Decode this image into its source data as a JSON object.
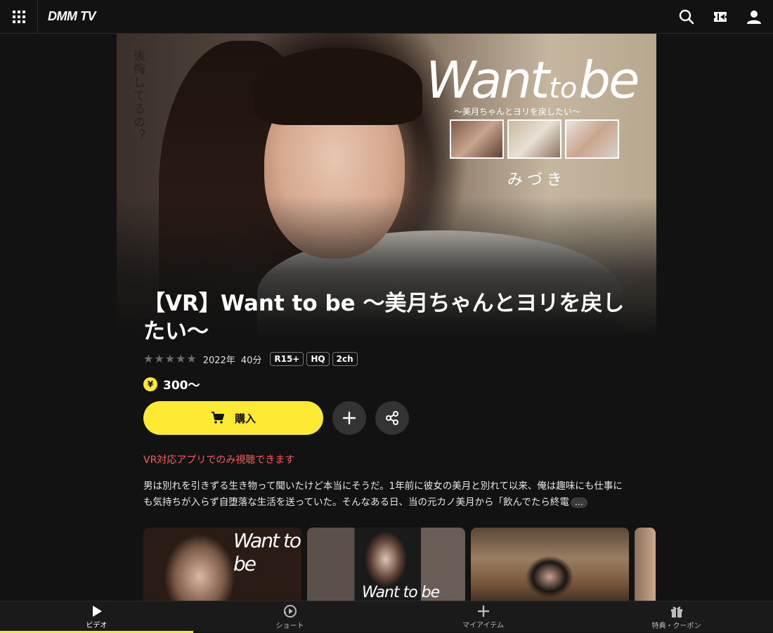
{
  "header": {
    "logo": "DMM TV",
    "icons": [
      "grid-menu-icon",
      "search-icon",
      "ticket-icon",
      "user-icon"
    ]
  },
  "hero": {
    "vertical_text": "後悔してるの？",
    "brand_want": "Want",
    "brand_to": "to",
    "brand_be": "be",
    "brand_sub": "〜美月ちゃんとヨリを戻したい〜",
    "actress": "みづき"
  },
  "content": {
    "title": "【VR】Want to be 〜美月ちゃんとヨリを戻したい〜",
    "rating_stars": 0,
    "year": "2022年",
    "duration": "40分",
    "badges": [
      "R15+",
      "HQ",
      "2ch"
    ],
    "currency_symbol": "¥",
    "price": "300〜",
    "buy_label": "購入",
    "vr_note": "VR対応アプリでのみ視聴できます",
    "description": "男は別れを引きずる生き物って聞いたけど本当にそうだ。1年前に彼女の美月と別れて以来、俺は趣味にも仕事にも気持ちが入らず自堕落な生活を送っていた。そんなある日、当の元カノ美月から「飲んでたら終電",
    "more_label": "…"
  },
  "gallery": {
    "thumb1_text": "Want to be",
    "thumb2_text": "Want to be"
  },
  "bottom_nav": {
    "items": [
      {
        "label": "ビデオ",
        "icon": "play-icon",
        "active": true
      },
      {
        "label": "ショート",
        "icon": "short-play-icon",
        "active": false
      },
      {
        "label": "マイアイテム",
        "icon": "plus-icon",
        "active": false
      },
      {
        "label": "特典・クーポン",
        "icon": "gift-icon",
        "active": false
      }
    ]
  },
  "colors": {
    "accent": "#ffea33",
    "background": "#121212",
    "warning": "#ff5a5a"
  }
}
